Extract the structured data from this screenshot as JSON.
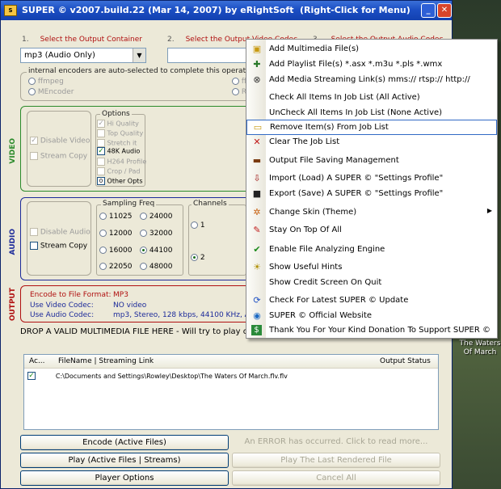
{
  "window": {
    "title": "SUPER © v2007.build.22 (Mar 14, 2007) by eRightSoft",
    "title_hint": "(Right-Click for Menu)",
    "app_icon_text": "S"
  },
  "steps": {
    "s1_num": "1.",
    "s1": "Select the Output Container",
    "s2_num": "2.",
    "s2": "Select the Output Video Codec",
    "s3_num": "3.",
    "s3": "Select the Output Audio Codec"
  },
  "container_combo": {
    "value": "mp3  (Audio Only)"
  },
  "video_codec_combo": {
    "value": ""
  },
  "encoders": {
    "note": "internal encoders are auto-selected to complete this operation",
    "ffmpeg": "ffmpeg",
    "mencoder": "MEncoder",
    "ff_partial": "ff",
    "r_partial": "R"
  },
  "video": {
    "section_label": "VIDEO",
    "disable": "Disable Video",
    "stream_copy": "Stream Copy",
    "options_title": "Options",
    "options": [
      "Hi Quality",
      "Top Quality",
      "Stretch it",
      "48K Audio",
      "H264 Profile",
      "Crop / Pad",
      "Other Opts"
    ],
    "other_opts_box": "0"
  },
  "audio": {
    "section_label": "AUDIO",
    "disable": "Disable Audio",
    "stream_copy": "Stream Copy",
    "sampling_title": "Sampling Freq",
    "freqs": [
      "11025",
      "24000",
      "12000",
      "32000",
      "16000",
      "44100",
      "22050",
      "48000"
    ],
    "channels_title": "Channels",
    "ch1": "1",
    "ch2": "2"
  },
  "output": {
    "section_label": "OUTPUT",
    "fmt_label": "Encode to File Format:",
    "fmt_value": "MP3",
    "vcodec_label": "Use Video Codec:",
    "vcodec_value": "NO video",
    "acodec_label": "Use Audio Codec:",
    "acodec_value": "mp3,  Stereo,  128 kbps,  44100 KHz,  Au"
  },
  "drop_text": "DROP A VALID MULTIMEDIA FILE HERE - Will try to play or",
  "joblist": {
    "col_active": "Ac...",
    "col_file": "FileName  |  Streaming Link",
    "col_status": "Output Status",
    "rows": [
      {
        "file": "C:\\Documents and Settings\\Rowley\\Desktop\\The Waters Of March.flv.flv",
        "status": ""
      }
    ]
  },
  "buttons": {
    "encode": "Encode (Active Files)",
    "error": "An ERROR has occurred. Click to read more...",
    "play": "Play (Active Files | Streams)",
    "play_last": "Play The Last Rendered File",
    "player_options": "Player Options",
    "cancel_all": "Cancel All"
  },
  "desktop": {
    "label": "The Waters Of March"
  },
  "menu": {
    "items": [
      {
        "label": "Add Multimedia File(s)",
        "icon": "folder-add-icon"
      },
      {
        "label": "Add Playlist File(s)   *.asx  *.m3u  *.pls  *.wmx",
        "icon": "playlist-add-icon"
      },
      {
        "label": "Add Media Streaming Link(s)   mms://  rtsp://  http://",
        "icon": "satellite-icon"
      },
      {
        "label": "Check All Items In Job List (All Active)",
        "icon": ""
      },
      {
        "label": "UnCheck All Items In Job List (None Active)",
        "icon": ""
      },
      {
        "label": "Remove Item(s) From Job List",
        "icon": "folder-remove-icon"
      },
      {
        "label": "Clear The Job List",
        "icon": "red-x-icon"
      },
      {
        "label": "Output File Saving Management",
        "icon": "hard-drive-icon"
      },
      {
        "label": "Import (Load) A SUPER © \"Settings Profile\"",
        "icon": "import-icon"
      },
      {
        "label": "Export (Save) A SUPER © \"Settings Profile\"",
        "icon": "floppy-icon"
      },
      {
        "label": "Change Skin (Theme)",
        "icon": "butterfly-icon"
      },
      {
        "label": "Stay On Top Of All",
        "icon": "pushpin-icon"
      },
      {
        "label": "Enable File Analyzing Engine",
        "icon": "checkmark-icon"
      },
      {
        "label": "Show Useful Hints",
        "icon": "lightbulb-icon"
      },
      {
        "label": "Show Credit Screen On Quit",
        "icon": ""
      },
      {
        "label": "Check For Latest SUPER © Update",
        "icon": "update-icon"
      },
      {
        "label": "SUPER © Official Website",
        "icon": "globe-icon"
      },
      {
        "label": "Thank You For Your Kind Donation To Support SUPER ©",
        "icon": "dollar-icon"
      }
    ],
    "submenu_arrow": "▶"
  },
  "colors": {
    "titlebar": "#1c4fc4",
    "step_red": "#b01010",
    "video_green": "#2a8a2a",
    "audio_blue": "#1c2a9a",
    "output_red": "#b01010"
  }
}
